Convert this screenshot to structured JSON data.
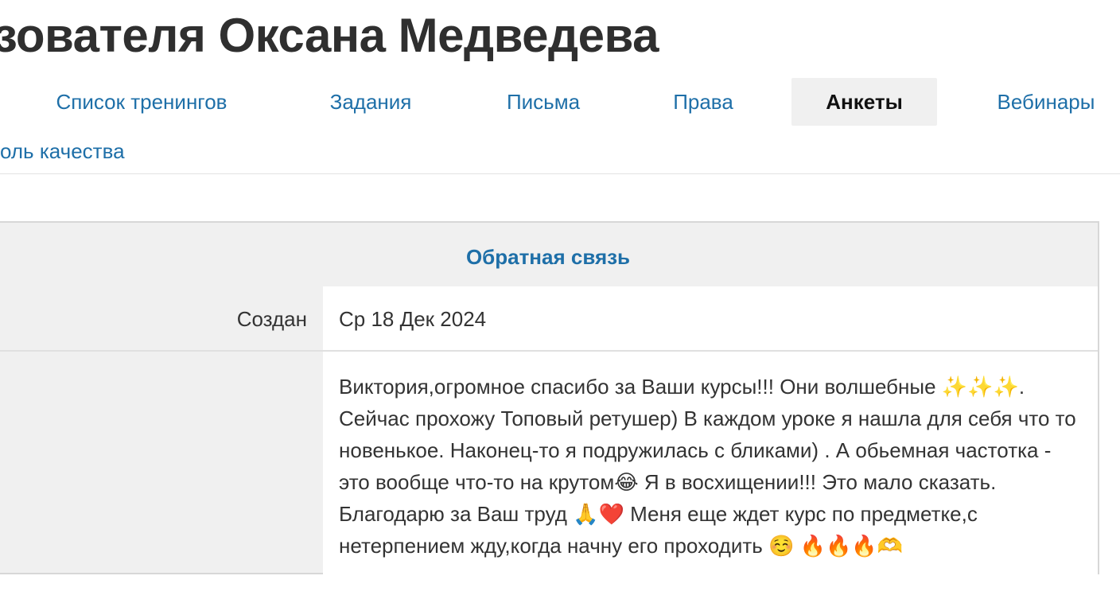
{
  "page": {
    "title": "зователя Оксана Медведева"
  },
  "tabs": [
    {
      "label": "Список тренингов",
      "active": false
    },
    {
      "label": "Задания",
      "active": false
    },
    {
      "label": "Письма",
      "active": false
    },
    {
      "label": "Права",
      "active": false
    },
    {
      "label": "Анкеты",
      "active": true
    },
    {
      "label": "Вебинары",
      "active": false
    }
  ],
  "tabs_row2": [
    {
      "label": "оль качества",
      "active": false
    }
  ],
  "card": {
    "header": "Обратная связь",
    "created_label": "Создан",
    "created_value": "Ср 18 Дек 2024",
    "feedback_text": "Виктория,огромное спасибо за Ваши курсы!!! Они волшебные ✨✨✨. Сейчас прохожу Топовый ретушер) В каждом уроке я нашла для себя что то новенькое. Наконец-то я подружилась с бликами) . А обьемная частотка - это вообще что-то на крутом😂 Я в восхищении!!! Это мало сказать. Благодарю за Ваш труд 🙏❤️ Меня еще ждет курс по предметке,с нетерпением жду,когда начну его проходить ☺️ 🔥🔥🔥🫶"
  },
  "colors": {
    "link": "#1e6fa8",
    "active_tab_bg": "#f0f0f0",
    "card_bg": "#f0f0f0"
  }
}
